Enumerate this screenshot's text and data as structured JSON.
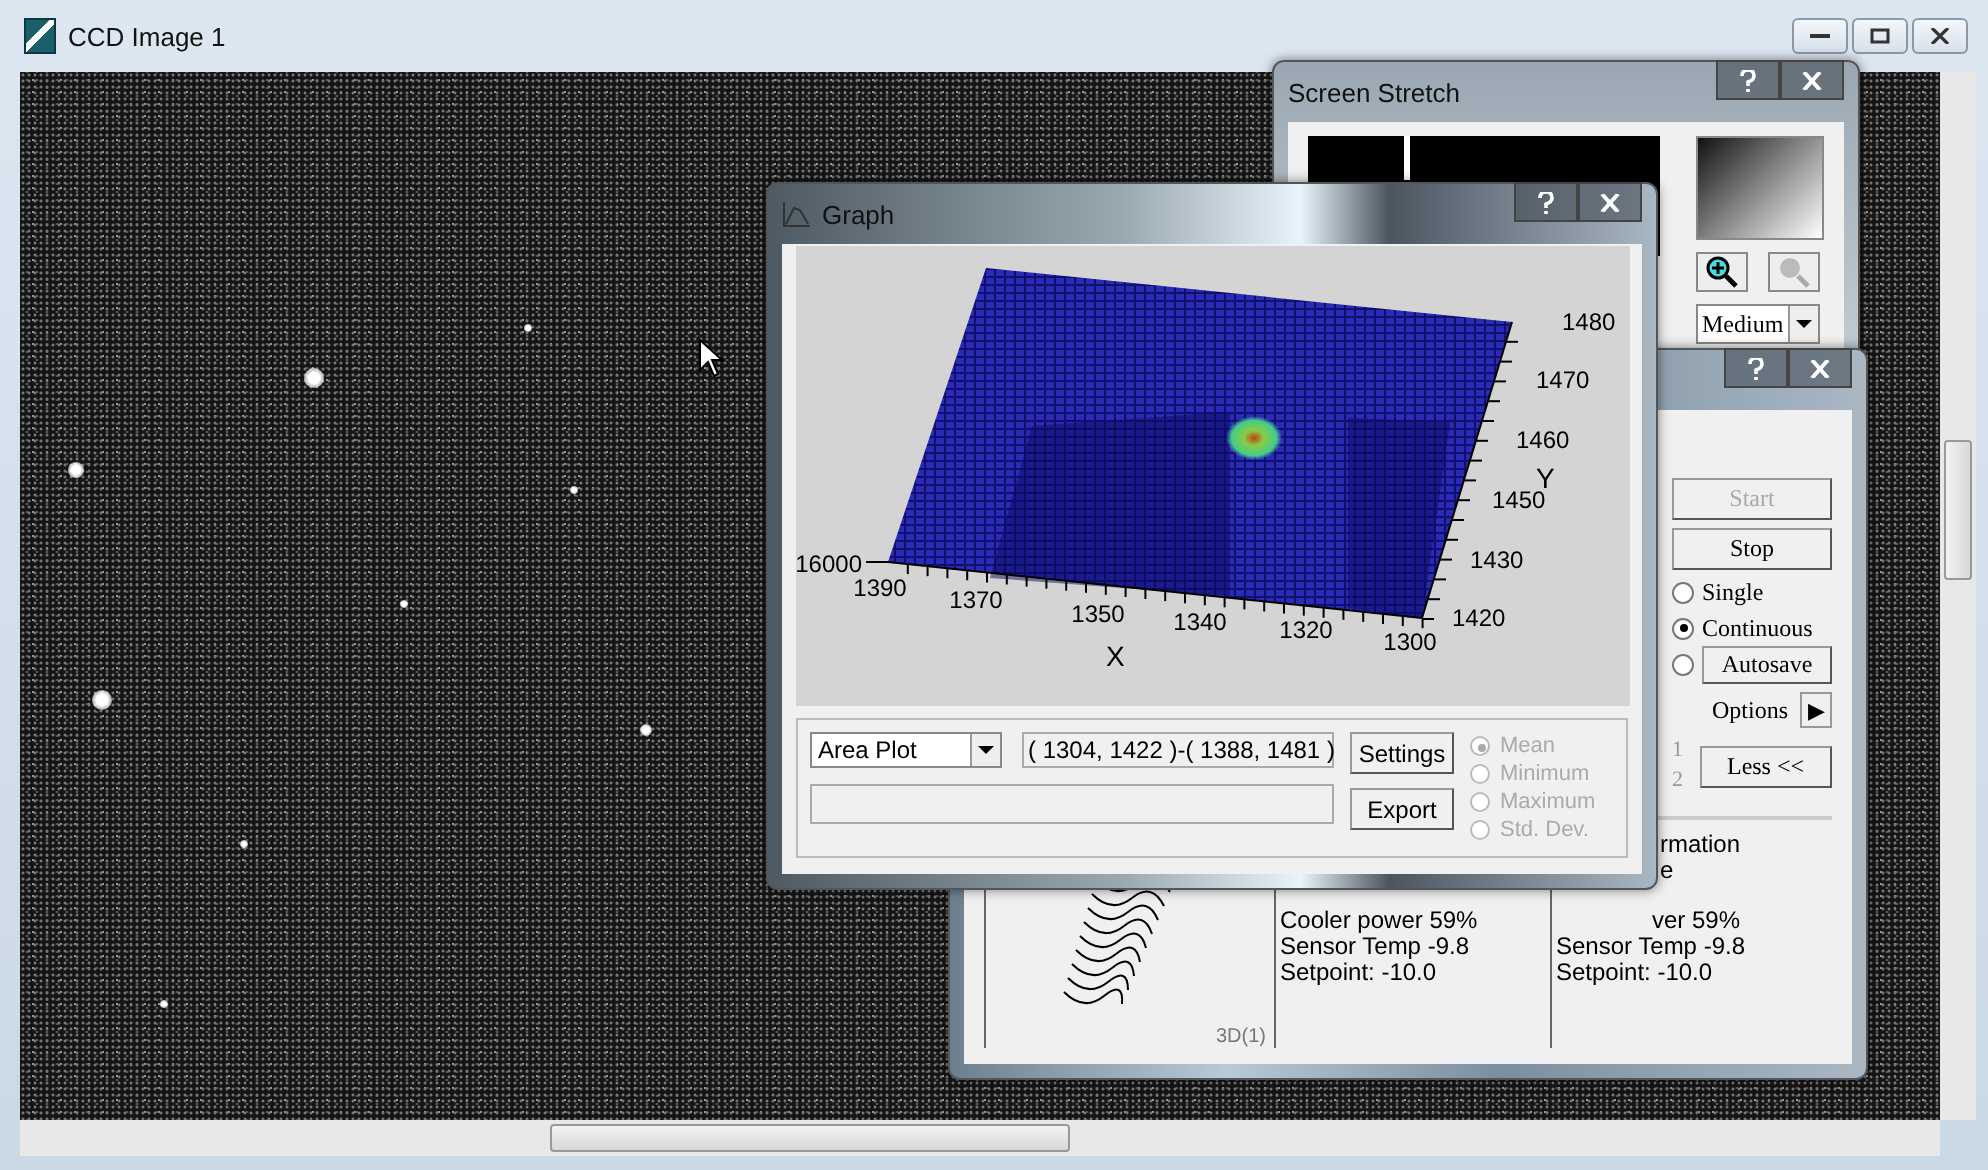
{
  "main_window": {
    "title": "CCD Image 1"
  },
  "screen_stretch": {
    "title": "Screen Stretch",
    "stretch_mode": "Medium"
  },
  "camera_window": {
    "buttons": [
      {
        "label": "Start",
        "disabled": true
      },
      {
        "label": "Stop",
        "disabled": false
      }
    ],
    "modes": [
      {
        "kind": "label",
        "label": "Single",
        "selected": false
      },
      {
        "kind": "label",
        "label": "Continuous",
        "selected": true
      },
      {
        "kind": "button",
        "label": "Autosave",
        "selected": false
      }
    ],
    "options_label": "Options",
    "options_arrow": "▶",
    "row_numbers": [
      "1",
      "2"
    ],
    "less_button": "Less <<",
    "info_fragments": [
      "rmation",
      "e"
    ],
    "plot_label": "3D(1)",
    "status_columns": [
      {
        "lines": [
          {
            "text": "Cooler power 59%",
            "partial": false
          },
          {
            "text": "Sensor Temp -9.8",
            "partial": false
          },
          {
            "text": "Setpoint: -10.0",
            "partial": false
          }
        ]
      },
      {
        "lines": [
          {
            "text": "ver 59%",
            "partial": true
          },
          {
            "text": "Sensor Temp -9.8",
            "partial": false
          },
          {
            "text": "Setpoint: -10.0",
            "partial": false
          }
        ]
      }
    ]
  },
  "graph_window": {
    "title": "Graph",
    "plot": {
      "x_label": "X",
      "y_label": "Y",
      "z_tick": "16000",
      "x_ticks": [
        "1390",
        "1370",
        "1350",
        "1340",
        "1320",
        "1300"
      ],
      "y_ticks": [
        "1480",
        "1470",
        "1460",
        "1450",
        "1430",
        "1420"
      ]
    },
    "plot_type": "Area Plot",
    "range": "( 1304, 1422 )-( 1388, 1481 )",
    "buttons": [
      "Settings",
      "Export"
    ],
    "statistics": [
      {
        "label": "Mean",
        "selected": true,
        "disabled": true
      },
      {
        "label": "Minimum",
        "selected": false,
        "disabled": true
      },
      {
        "label": "Maximum",
        "selected": false,
        "disabled": true
      },
      {
        "label": "Std. Dev.",
        "selected": false,
        "disabled": true
      }
    ]
  }
}
